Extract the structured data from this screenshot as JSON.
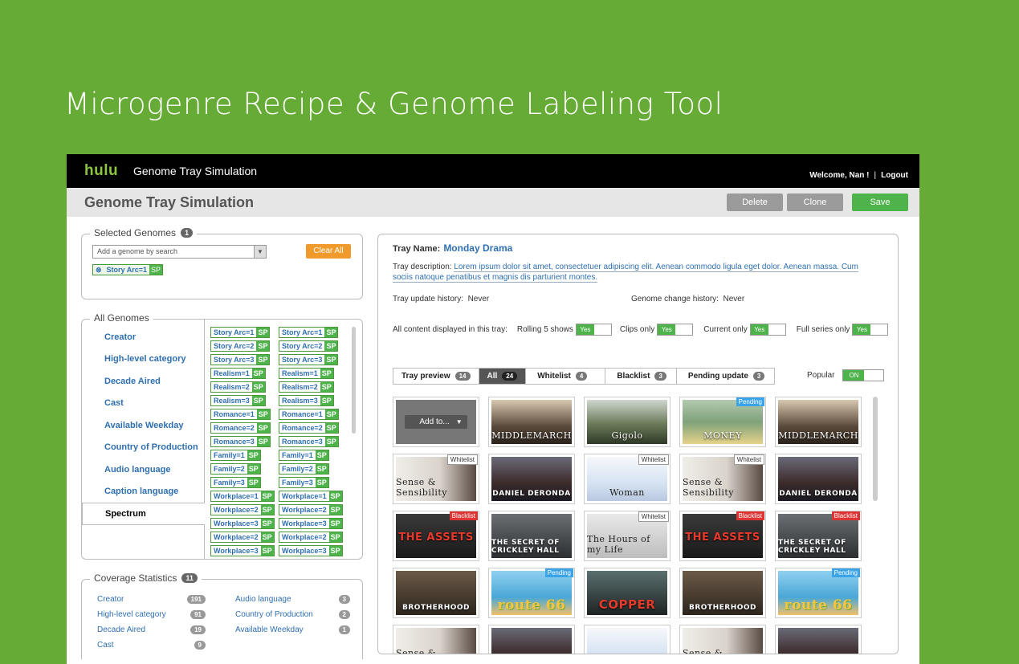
{
  "headline": "Microgenre Recipe & Genome Labeling Tool",
  "topbar": {
    "logo": "hulu",
    "app_title": "Genome Tray Simulation",
    "welcome": "Welcome, Nan !",
    "separator": "|",
    "logout": "Logout"
  },
  "page": {
    "title": "Genome Tray Simulation",
    "delete_label": "Delete",
    "clone_label": "Clone",
    "save_label": "Save"
  },
  "selected_genomes": {
    "legend": "Selected Genomes",
    "count": "1",
    "search_placeholder": "Add a genome by search",
    "clear_all_label": "Clear All",
    "tag_label": "Story Arc=1",
    "tag_sp": "SP"
  },
  "all_genomes": {
    "legend": "All Genomes",
    "categories": [
      "Creator",
      "High-level category",
      "Decade Aired",
      "Cast",
      "Available Weekday",
      "Country of Production",
      "Audio language",
      "Caption language",
      "Spectrum"
    ],
    "tags": [
      "Story Arc=1",
      "Story Arc=2",
      "Story Arc=3",
      "Realism=1",
      "Realism=2",
      "Realism=3",
      "Romance=1",
      "Romance=2",
      "Romance=3",
      "Family=1",
      "Family=2",
      "Family=3",
      "Workplace=1",
      "Workplace=2",
      "Workplace=3",
      "Workplace=2",
      "Workplace=3"
    ],
    "sp": "SP"
  },
  "coverage": {
    "legend": "Coverage Statistics",
    "count": "11",
    "rows": [
      {
        "l_label": "Creator",
        "l_count": "191",
        "r_label": "Audio language",
        "r_count": "3"
      },
      {
        "l_label": "High-level category",
        "l_count": "91",
        "r_label": "Country of Production",
        "r_count": "2"
      },
      {
        "l_label": "Decade Aired",
        "l_count": "19",
        "r_label": "Available Weekday",
        "r_count": "1"
      },
      {
        "l_label": "Cast",
        "l_count": "9",
        "r_label": "",
        "r_count": ""
      }
    ]
  },
  "tray": {
    "name_label": "Tray Name:",
    "name": "Monday Drama",
    "desc_label": "Tray description:",
    "desc": "Lorem ipsum dolor sit amet, consectetuer adipiscing elit. Aenean commodo ligula eget dolor. Aenean massa. Cum sociis natoque penatibus et magnis dis parturient montes.",
    "update_history_label": "Tray update history:",
    "update_history": "Never",
    "genome_history_label": "Genome change history:",
    "genome_history": "Never",
    "all_content_label": "All content displayed in this tray:",
    "options": [
      {
        "label": "Rolling 5 shows",
        "state": "Yes"
      },
      {
        "label": "Clips only",
        "state": "Yes"
      },
      {
        "label": "Current only",
        "state": "Yes"
      },
      {
        "label": "Full series only",
        "state": "Yes"
      }
    ],
    "tabs": [
      {
        "label": "Tray preview",
        "count": "14"
      },
      {
        "label": "All",
        "count": "24"
      },
      {
        "label": "Whitelist",
        "count": "4"
      },
      {
        "label": "Blacklist",
        "count": "3"
      },
      {
        "label": "Pending update",
        "count": "3"
      }
    ],
    "popular_label": "Popular",
    "popular_state": "ON",
    "add_to_label": "Add to...",
    "thumbs": [
      {
        "title": "",
        "badge": "",
        "pal": "a"
      },
      {
        "title": "MIDDLEMARCH",
        "badge": "",
        "pal": "a"
      },
      {
        "title": "Gigolo",
        "badge": "",
        "pal": "b"
      },
      {
        "title": "MONEY",
        "badge": "Pending",
        "pal": "c"
      },
      {
        "title": "MIDDLEMARCH",
        "badge": "",
        "pal": "a"
      },
      {
        "title": "Sense & Sensibility",
        "badge": "Whitelist",
        "pal": "d"
      },
      {
        "title": "DANIEL DERONDA",
        "badge": "",
        "pal": "e"
      },
      {
        "title": "Woman",
        "badge": "Whitelist",
        "pal": "f"
      },
      {
        "title": "Sense & Sensibility",
        "badge": "Whitelist",
        "pal": "d"
      },
      {
        "title": "DANIEL DERONDA",
        "badge": "",
        "pal": "e"
      },
      {
        "title": "THE ASSETS",
        "badge": "Blacklist",
        "pal": "g"
      },
      {
        "title": "THE SECRET OF CRICKLEY HALL",
        "badge": "",
        "pal": "h"
      },
      {
        "title": "The Hours of my Life",
        "badge": "Whitelist",
        "pal": "i"
      },
      {
        "title": "THE ASSETS",
        "badge": "Blacklist",
        "pal": "g"
      },
      {
        "title": "THE SECRET OF CRICKLEY HALL",
        "badge": "Blacklist",
        "pal": "h"
      },
      {
        "title": "BROTHERHOOD",
        "badge": "",
        "pal": "j"
      },
      {
        "title": "route 66",
        "badge": "Pending",
        "pal": "k"
      },
      {
        "title": "COPPER",
        "badge": "",
        "pal": "l"
      },
      {
        "title": "BROTHERHOOD",
        "badge": "",
        "pal": "j"
      },
      {
        "title": "route 66",
        "badge": "Pending",
        "pal": "k"
      },
      {
        "title": "Sense & Sensibility",
        "badge": "",
        "pal": "d"
      },
      {
        "title": "",
        "badge": "",
        "pal": "e"
      },
      {
        "title": "",
        "badge": "",
        "pal": "f"
      },
      {
        "title": "Sense & Sensibility",
        "badge": "",
        "pal": "d"
      },
      {
        "title": "",
        "badge": "",
        "pal": "e"
      }
    ]
  },
  "colors": {
    "background": "#66ab35",
    "accent_green": "#4db34a",
    "link_blue": "#2f6fb0",
    "clear_orange": "#f09a2b",
    "pending_blue": "#3ba3e8",
    "blacklist_red": "#dd3333"
  }
}
